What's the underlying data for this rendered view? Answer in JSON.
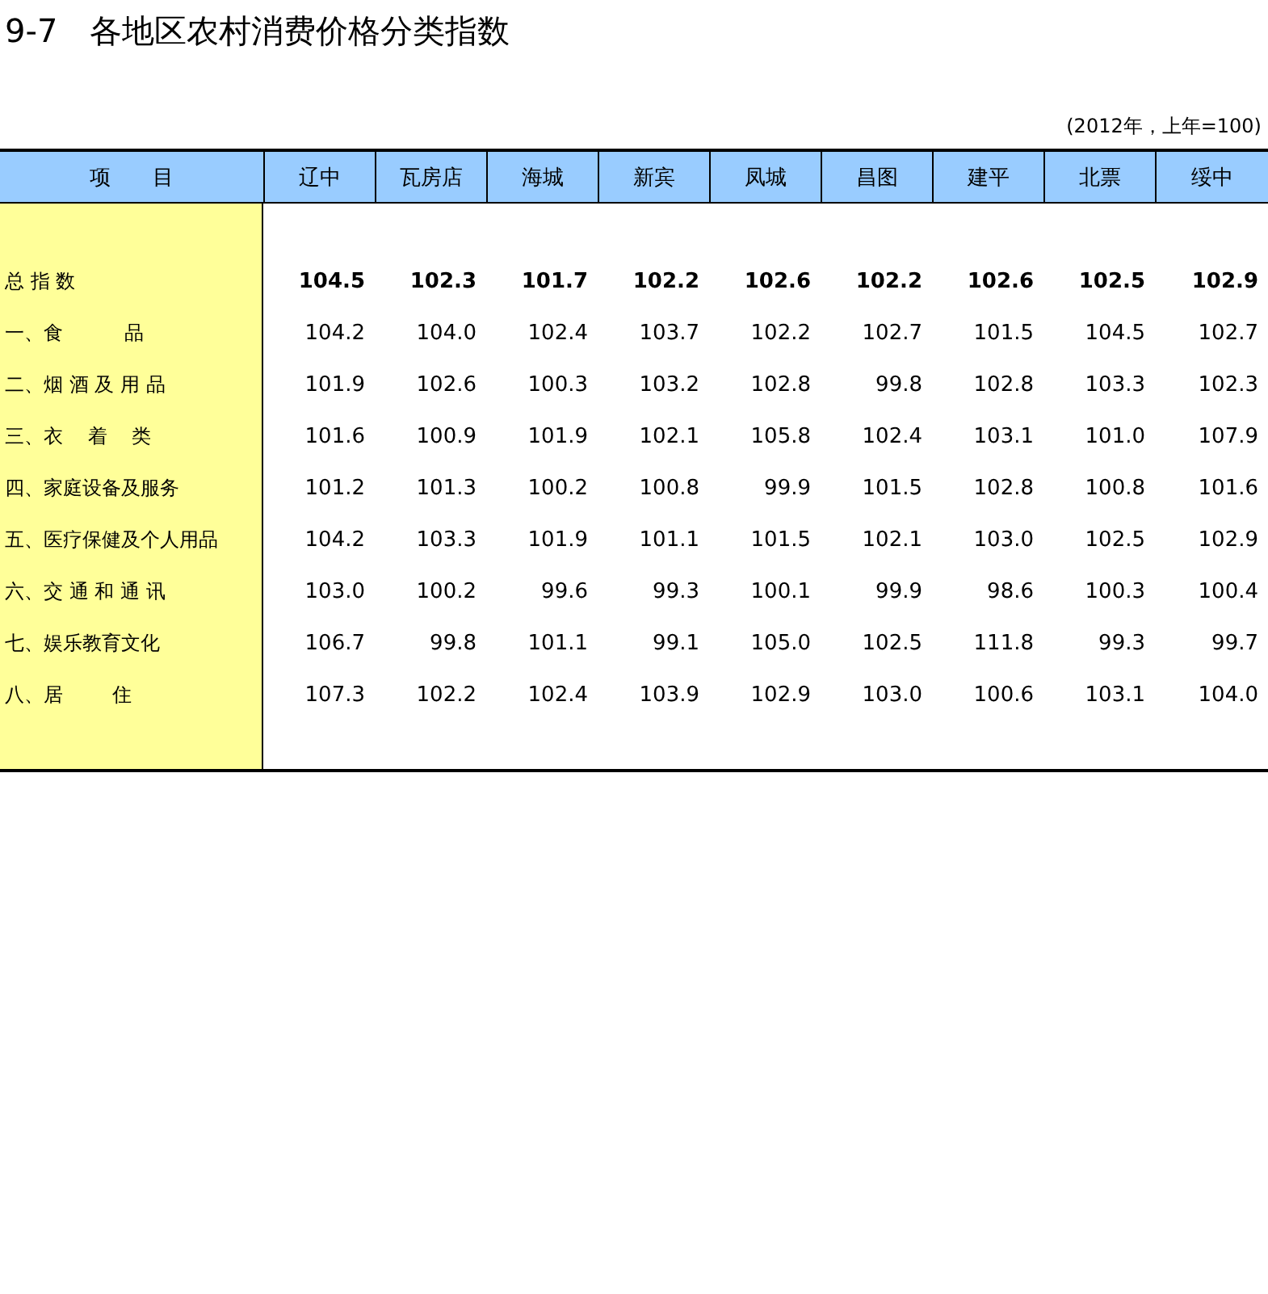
{
  "title": "9-7　各地区农村消费价格分类指数",
  "note": "(2012年，上年=100)",
  "table": {
    "columns": [
      "项　　目",
      "辽中",
      "瓦房店",
      "海城",
      "新宾",
      "凤城",
      "昌图",
      "建平",
      "北票",
      "绥中"
    ],
    "rows": [
      {
        "kind": "total",
        "label": "总 指 数",
        "values": [
          "104.5",
          "102.3",
          "101.7",
          "102.2",
          "102.6",
          "102.2",
          "102.6",
          "102.5",
          "102.9"
        ]
      },
      {
        "kind": "item",
        "label": "一、食          品",
        "values": [
          "104.2",
          "104.0",
          "102.4",
          "103.7",
          "102.2",
          "102.7",
          "101.5",
          "104.5",
          "102.7"
        ]
      },
      {
        "kind": "item",
        "label": "二、烟 酒 及 用 品",
        "values": [
          "101.9",
          "102.6",
          "100.3",
          "103.2",
          "102.8",
          "99.8",
          "102.8",
          "103.3",
          "102.3"
        ]
      },
      {
        "kind": "item",
        "label": "三、衣    着    类",
        "values": [
          "101.6",
          "100.9",
          "101.9",
          "102.1",
          "105.8",
          "102.4",
          "103.1",
          "101.0",
          "107.9"
        ]
      },
      {
        "kind": "item",
        "label": "四、家庭设备及服务",
        "values": [
          "101.2",
          "101.3",
          "100.2",
          "100.8",
          "99.9",
          "101.5",
          "102.8",
          "100.8",
          "101.6"
        ]
      },
      {
        "kind": "item",
        "label": "五、医疗保健及个人用品",
        "values": [
          "104.2",
          "103.3",
          "101.9",
          "101.1",
          "101.5",
          "102.1",
          "103.0",
          "102.5",
          "102.9"
        ]
      },
      {
        "kind": "item",
        "label": "六、交 通 和 通 讯",
        "values": [
          "103.0",
          "100.2",
          "99.6",
          "99.3",
          "100.1",
          "99.9",
          "98.6",
          "100.3",
          "100.4"
        ]
      },
      {
        "kind": "item",
        "label": "七、娱乐教育文化",
        "values": [
          "106.7",
          "99.8",
          "101.1",
          "99.1",
          "105.0",
          "102.5",
          "111.8",
          "99.3",
          "99.7"
        ]
      },
      {
        "kind": "item",
        "label": "八、居        住",
        "values": [
          "107.3",
          "102.2",
          "102.4",
          "103.9",
          "102.9",
          "103.0",
          "100.6",
          "103.1",
          "104.0"
        ]
      }
    ]
  }
}
